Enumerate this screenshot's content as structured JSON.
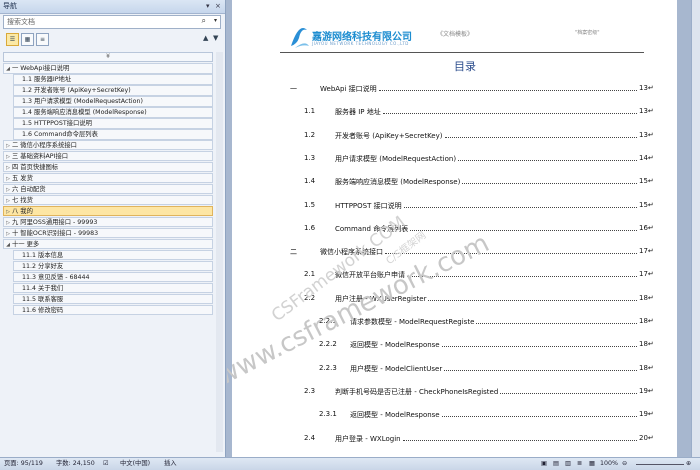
{
  "nav": {
    "title": "导航",
    "search_placeholder": "搜索文档",
    "collapse_glyph": "¥",
    "tree": [
      {
        "level": 0,
        "text": "一 WebApi接口说明",
        "expanded": true
      },
      {
        "level": 1,
        "text": "1.1 服务器IP地址"
      },
      {
        "level": 1,
        "text": "1.2 开发者账号 (ApiKey+SecretKey)"
      },
      {
        "level": 1,
        "text": "1.3 用户请求模型 (ModelRequestAction)"
      },
      {
        "level": 1,
        "text": "1.4 服务端响应消息模型 (ModelResponse)"
      },
      {
        "level": 1,
        "text": "1.5 HTTPPOST接口说明"
      },
      {
        "level": 1,
        "text": "1.6 Command命令层列表"
      },
      {
        "level": 0,
        "text": "二 微信小程序系统接口",
        "expanded": false
      },
      {
        "level": 0,
        "text": "三 基础资料API接口",
        "expanded": false
      },
      {
        "level": 0,
        "text": "四 首页快捷图标",
        "expanded": false
      },
      {
        "level": 0,
        "text": "五 发货",
        "expanded": false
      },
      {
        "level": 0,
        "text": "六 自动配货",
        "expanded": false
      },
      {
        "level": 0,
        "text": "七 找货",
        "expanded": false
      },
      {
        "level": 0,
        "text": "八 我的",
        "expanded": false,
        "selected": true
      },
      {
        "level": 0,
        "text": "九 阿里OSS通用接口 - 99993",
        "expanded": false
      },
      {
        "level": 0,
        "text": "十 智能OCR识别接口 - 99983",
        "expanded": false
      },
      {
        "level": 0,
        "text": "十一 更多",
        "expanded": true
      },
      {
        "level": 1,
        "text": "11.1 版本信息"
      },
      {
        "level": 1,
        "text": "11.2 分享好友"
      },
      {
        "level": 1,
        "text": "11.3 意见反馈 - 68444"
      },
      {
        "level": 1,
        "text": "11.4 关于我们"
      },
      {
        "level": 1,
        "text": "11.5 联系客服"
      },
      {
        "level": 1,
        "text": "11.6 修改密码"
      }
    ]
  },
  "status": {
    "page": "页面: 95/119",
    "words": "字数: 24,150",
    "lang": "中文(中国)",
    "mode": "插入",
    "zoom": "100%"
  },
  "doc": {
    "logo": "嘉游网络科技有限公司",
    "logo_sub": "JIAYOU NETWORK TECHNOLOGY CO.,LTD",
    "hdr_center": "《文档模板》",
    "hdr_right": "\"档案密级\"",
    "toc_title": "目录",
    "toc": [
      {
        "num": "一",
        "text": "WebApi 接口说明",
        "page": "13",
        "lvl": 0
      },
      {
        "num": "1.1",
        "text": "服务器 IP 地址",
        "page": "13",
        "lvl": 1
      },
      {
        "num": "1.2",
        "text": "开发者账号 (ApiKey+SecretKey)",
        "page": "13",
        "lvl": 1
      },
      {
        "num": "1.3",
        "text": "用户请求模型 (ModelRequestAction)",
        "page": "14",
        "lvl": 1
      },
      {
        "num": "1.4",
        "text": "服务端响应消息模型 (ModelResponse)",
        "page": "15",
        "lvl": 1
      },
      {
        "num": "1.5",
        "text": "HTTPPOST 接口说明",
        "page": "15",
        "lvl": 1
      },
      {
        "num": "1.6",
        "text": "Command 命令层列表",
        "page": "16",
        "lvl": 1
      },
      {
        "num": "二",
        "text": "微信小程序系统接口",
        "page": "17",
        "lvl": 0
      },
      {
        "num": "2.1",
        "text": "微信开放平台账户申请",
        "page": "17",
        "lvl": 1
      },
      {
        "num": "2.2",
        "text": "用户注册 - WXUserRegister",
        "page": "18",
        "lvl": 1
      },
      {
        "num": "2.2.1",
        "text": "请求参数模型 - ModelRequestRegiste",
        "page": "18",
        "lvl": 2
      },
      {
        "num": "2.2.2",
        "text": "返回模型 - ModelResponse",
        "page": "18",
        "lvl": 2
      },
      {
        "num": "2.2.3",
        "text": "用户模型 - ModelClientUser",
        "page": "18",
        "lvl": 2
      },
      {
        "num": "2.3",
        "text": "判断手机号码是否已注册 - CheckPhoneIsRegisted",
        "page": "19",
        "lvl": 1
      },
      {
        "num": "2.3.1",
        "text": "返回模型 - ModelResponse",
        "page": "19",
        "lvl": 2
      },
      {
        "num": "2.4",
        "text": "用户登录 - WXLogin",
        "page": "20",
        "lvl": 1
      }
    ],
    "watermark1": "www.csframework.com",
    "watermark2": "CSFramework.COM",
    "watermark3": "C/S框架网"
  }
}
